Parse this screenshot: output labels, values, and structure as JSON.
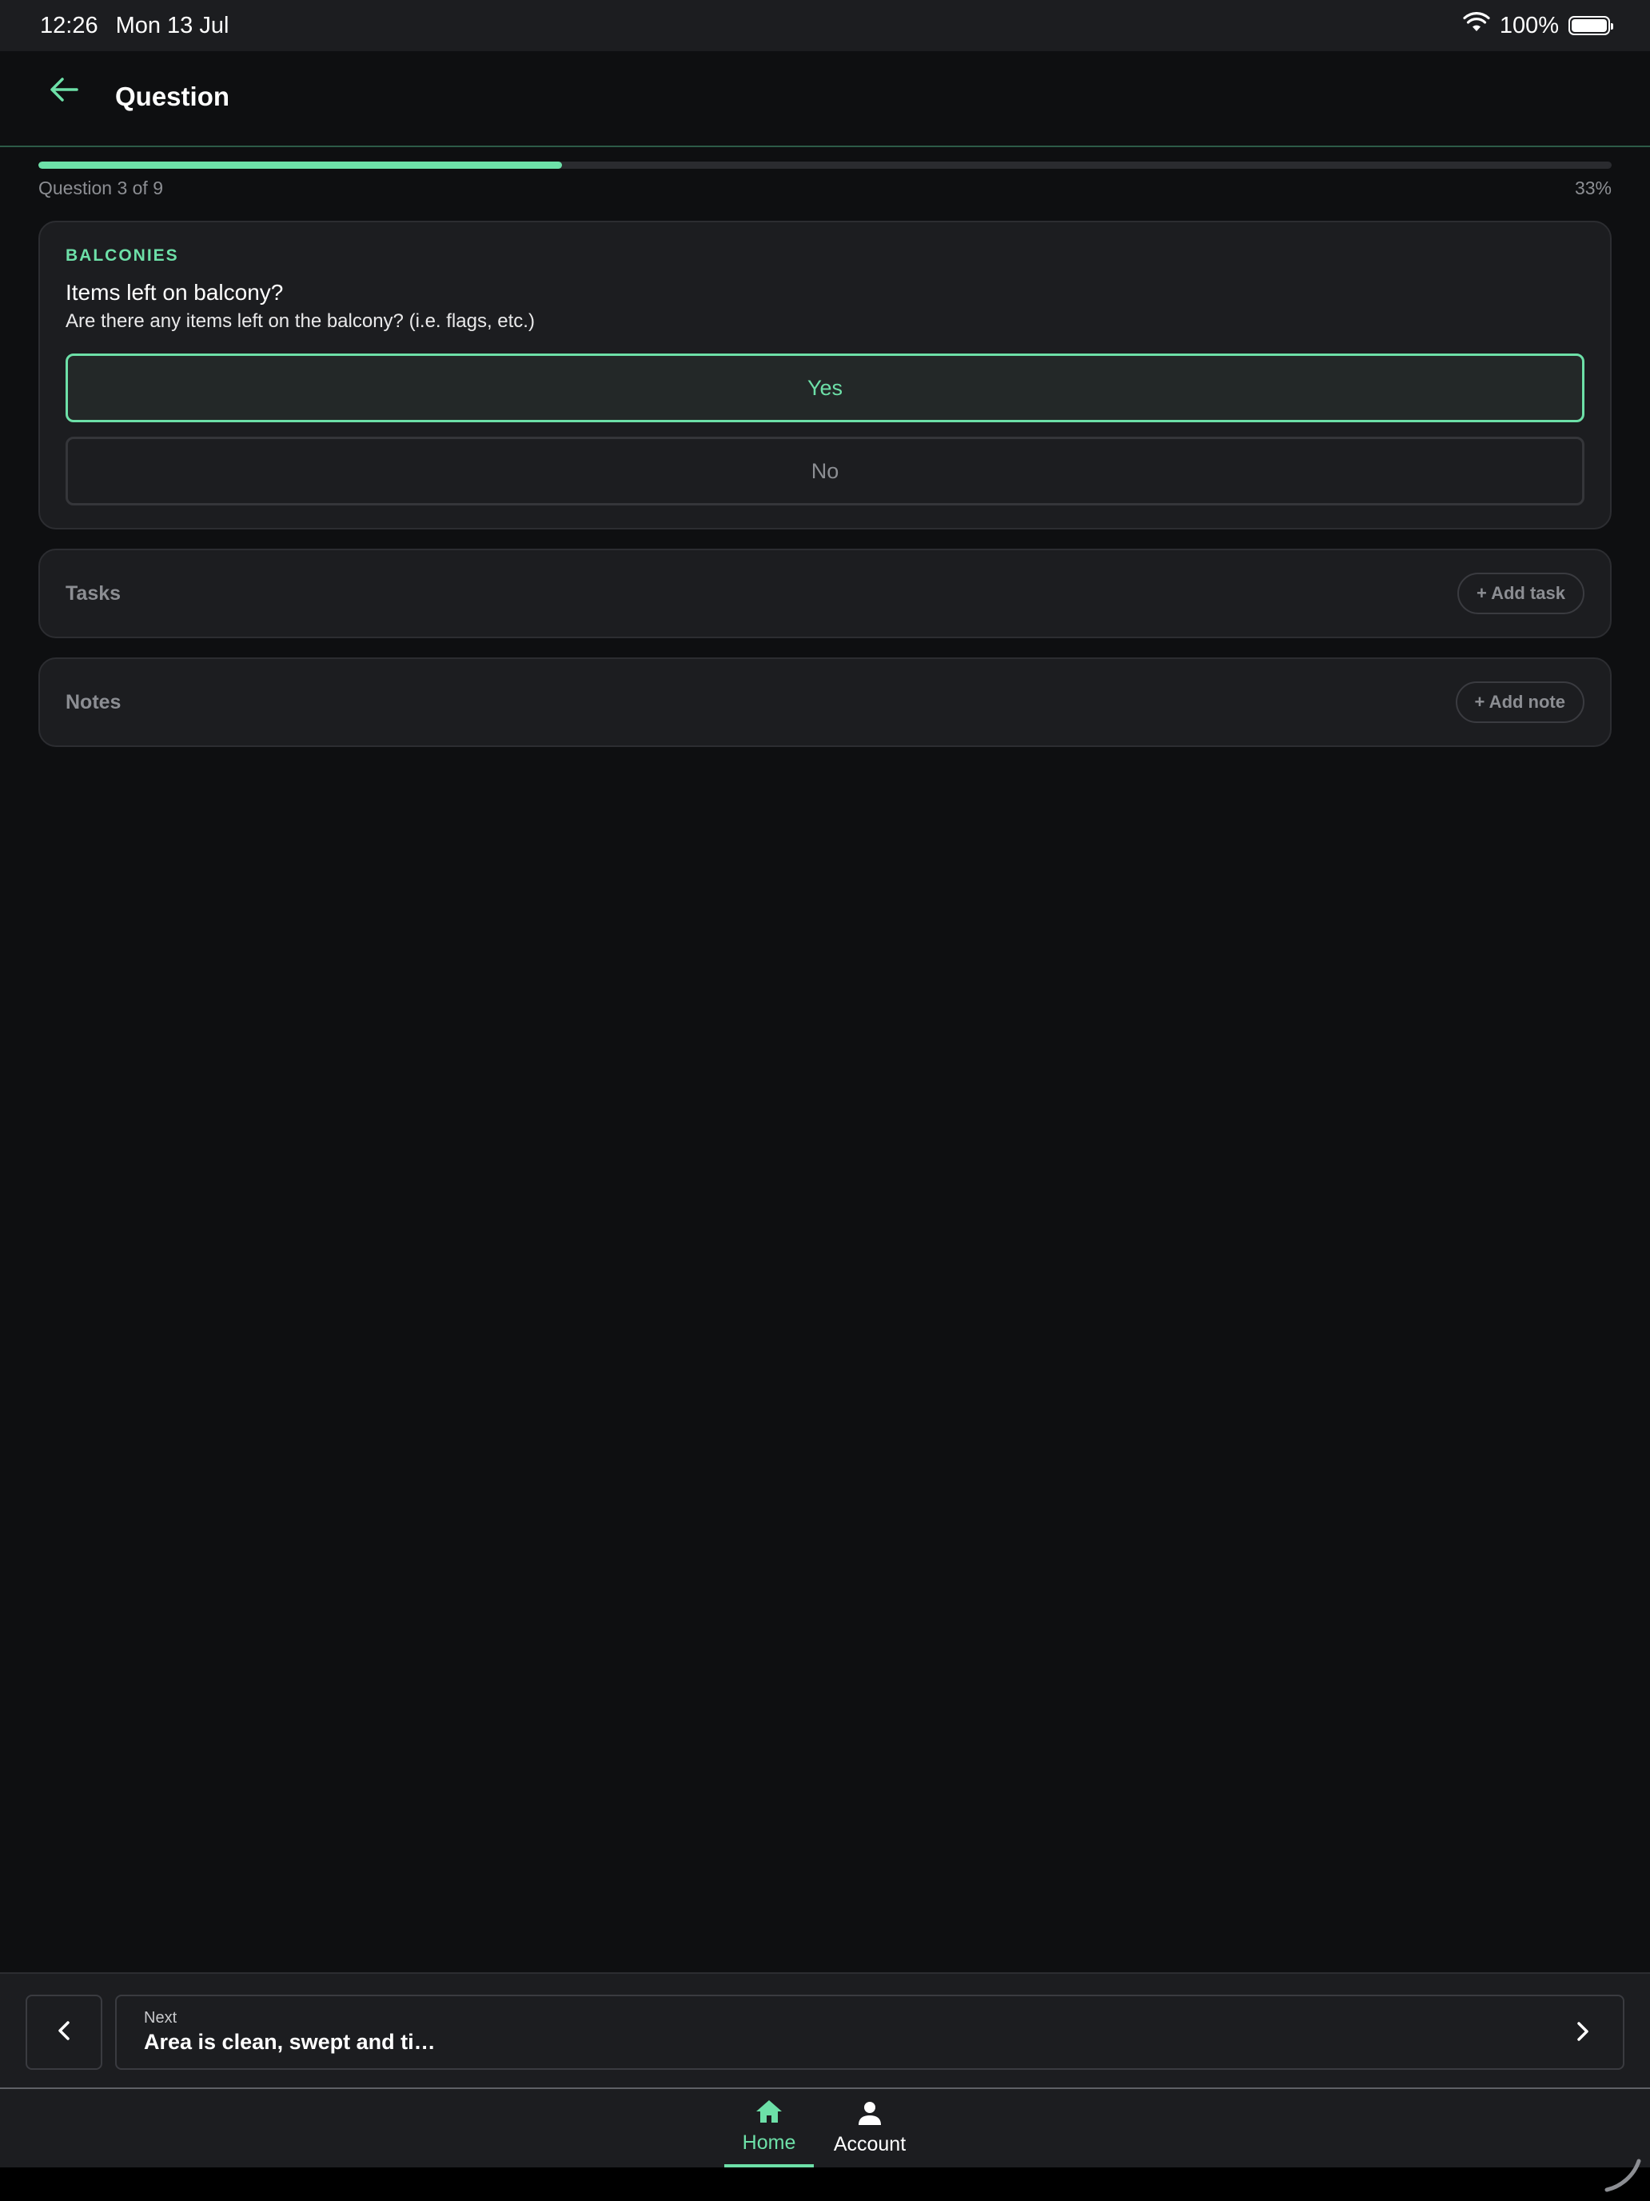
{
  "status_bar": {
    "time": "12:26",
    "date": "Mon 13 Jul",
    "battery": "100%",
    "icons": {
      "wifi": "wifi-icon",
      "battery": "battery-icon"
    }
  },
  "header": {
    "title": "Question",
    "back_icon": "arrow-left-icon"
  },
  "progress": {
    "label": "Question 3 of 9",
    "percent_text": "33%",
    "fill_fraction": 0.333
  },
  "question": {
    "category": "BALCONIES",
    "title": "Items left on balcony?",
    "description": "Are there any items left on the balcony? (i.e. flags, etc.)",
    "options": [
      {
        "label": "Yes",
        "selected": true
      },
      {
        "label": "No",
        "selected": false
      }
    ]
  },
  "tasks": {
    "label": "Tasks",
    "add_label": "+ Add task"
  },
  "notes": {
    "label": "Notes",
    "add_label": "+ Add note"
  },
  "navigation": {
    "next_caption": "Next",
    "next_title": "Area is clean, swept and ti…",
    "prev_icon": "chevron-left-icon",
    "next_icon": "chevron-right-icon"
  },
  "tab_bar": {
    "items": [
      {
        "label": "Home",
        "icon": "home-icon",
        "active": true
      },
      {
        "label": "Account",
        "icon": "person-icon",
        "active": false
      }
    ]
  },
  "colors": {
    "accent": "#6de0a8",
    "background": "#0e0f11",
    "surface": "#1c1d20",
    "muted_text": "#8c8e93"
  }
}
